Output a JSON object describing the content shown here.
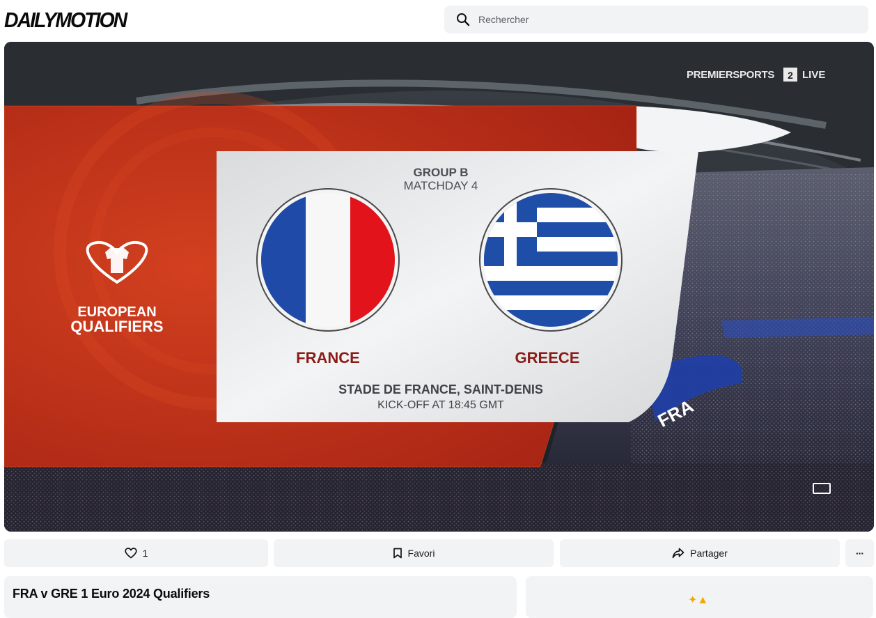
{
  "brand": {
    "logo_text": "DAILYMOTION"
  },
  "search": {
    "placeholder": "Rechercher",
    "icon": "search-icon"
  },
  "player": {
    "broadcaster": {
      "name": "PREMIERSPORTS",
      "channel": "2",
      "live": "LIVE"
    },
    "competition": {
      "line1": "EUROPEAN",
      "line2": "QUALIFIERS"
    },
    "match_card": {
      "group": "GROUP B",
      "matchday": "MATCHDAY 4",
      "home_team": "FRANCE",
      "away_team": "GREECE",
      "venue": "STADE DE FRANCE, SAINT-DENIS",
      "kickoff": "KICK-OFF AT 18:45 GMT"
    },
    "banner_text": "FRA",
    "colors": {
      "red_panel": "#c7361c",
      "team_text": "#8a1c18",
      "card_bg": "#e9eaeb"
    }
  },
  "actions": {
    "like": {
      "icon": "heart-icon",
      "count": "1"
    },
    "favorite": {
      "icon": "bookmark-icon",
      "label": "Favori"
    },
    "share": {
      "icon": "share-icon",
      "label": "Partager"
    },
    "more": {
      "icon": "more-icon",
      "label": "···"
    }
  },
  "video": {
    "title": "FRA v GRE 1 Euro 2024 Qualifiers"
  }
}
